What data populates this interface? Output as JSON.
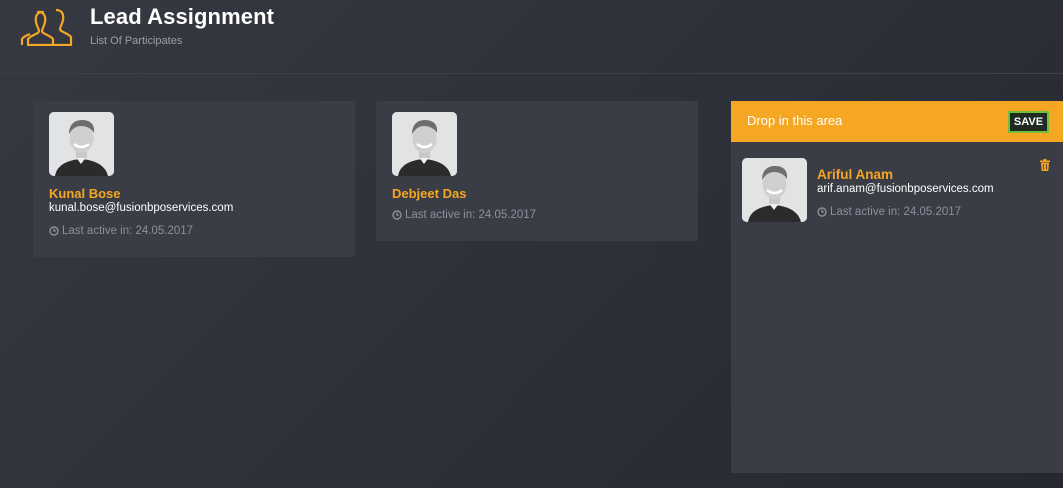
{
  "header": {
    "title": "Lead Assignment",
    "subtitle": "List Of Participates",
    "icon": "users-icon"
  },
  "participants": [
    {
      "name": "Kunal Bose",
      "email": "kunal.bose@fusionbposervices.com",
      "last_active": "Last active in: 24.05.2017"
    },
    {
      "name": "Debjeet Das",
      "email": "",
      "last_active": "Last active in: 24.05.2017"
    }
  ],
  "dropzone": {
    "label": "Drop in this area",
    "save_label": "SAVE",
    "assigned": [
      {
        "name": "Ariful Anam",
        "email": "arif.anam@fusionbposervices.com",
        "last_active": "Last active in: 24.05.2017"
      }
    ]
  },
  "colors": {
    "accent": "#f5a623",
    "background": "#2e3038",
    "card": "#3a3d46",
    "save_border": "#6fbf3a"
  }
}
